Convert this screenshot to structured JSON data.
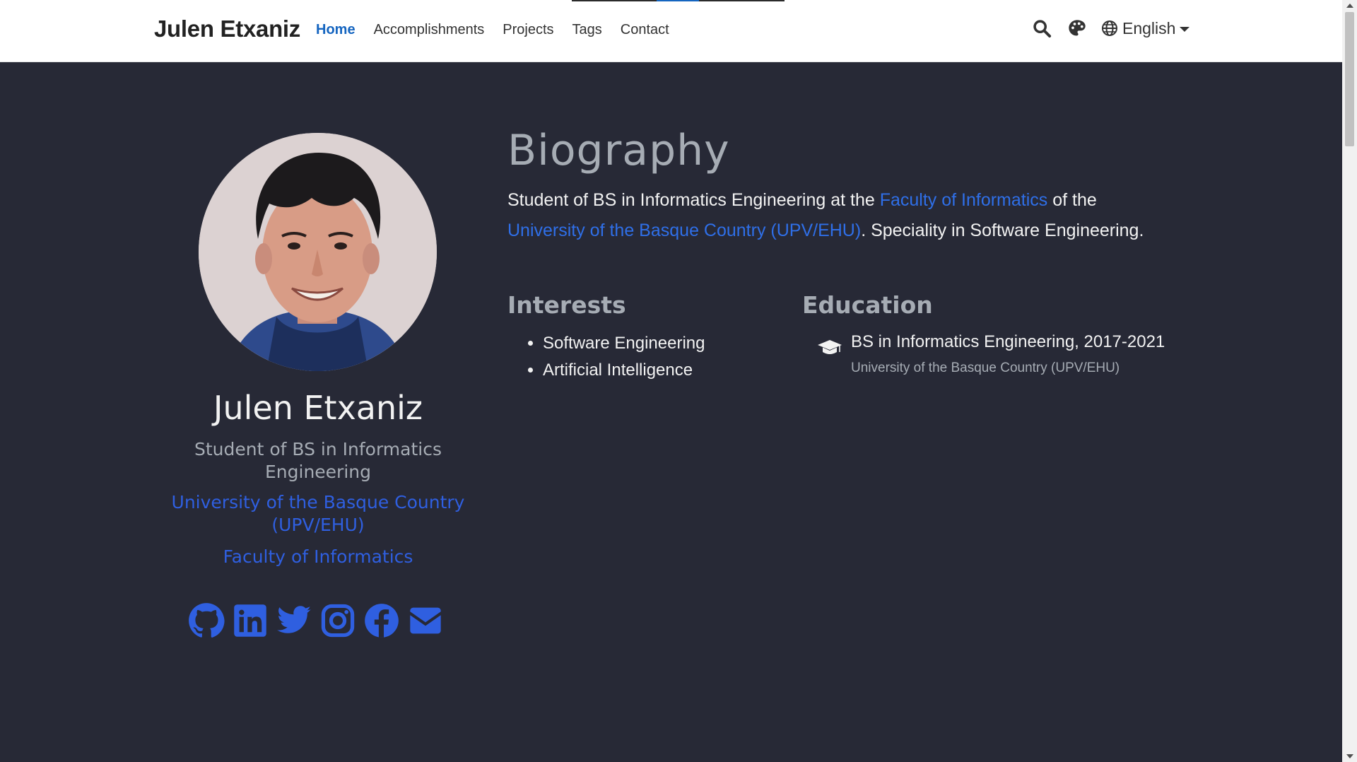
{
  "nav": {
    "brand": "Julen Etxaniz",
    "links": [
      "Home",
      "Accomplishments",
      "Projects",
      "Tags",
      "Contact"
    ],
    "active_index": 0,
    "language": "English",
    "icons": [
      "search-icon",
      "palette-icon",
      "globe-icon"
    ]
  },
  "profile": {
    "name": "Julen Etxaniz",
    "role": "Student of BS in Informatics Engineering",
    "organization": "University of the Basque Country (UPV/EHU)",
    "faculty": "Faculty of Informatics",
    "social_icons": [
      "github-icon",
      "linkedin-icon",
      "twitter-icon",
      "instagram-icon",
      "facebook-icon",
      "envelope-icon"
    ]
  },
  "biography": {
    "title": "Biography",
    "text_1": "Student of BS in Informatics Engineering at the ",
    "link_faculty": "Faculty of Informatics",
    "text_2": " of the ",
    "link_university": "University of the Basque Country (UPV/EHU)",
    "text_3": ". Speciality in Software Engineering."
  },
  "interests": {
    "title": "Interests",
    "items": [
      "Software Engineering",
      "Artificial Intelligence"
    ]
  },
  "education": {
    "title": "Education",
    "items": [
      {
        "degree": "BS in Informatics Engineering, 2017-2021",
        "institution": "University of the Basque Country (UPV/EHU)",
        "icon": "graduation-cap-icon"
      }
    ]
  },
  "colors": {
    "background": "#272936",
    "accent": "#2f5fe0",
    "nav_active": "#1565c0",
    "muted": "#a6acb4"
  }
}
